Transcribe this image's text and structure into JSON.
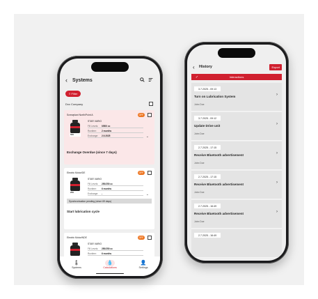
{
  "left": {
    "header": {
      "back": "‹",
      "title": "Systems",
      "search_icon": "search-icon",
      "sort_icon": "sort-icon"
    },
    "filter_label": "≡ Filter",
    "company": "Dxx Company",
    "cards": [
      {
        "name": "Screwplant North/Point A",
        "status": "OFF",
        "product": "STAR VARIO",
        "size": "500",
        "rows": [
          {
            "key": "Fill Levels:",
            "value": "0/500 cc"
          },
          {
            "key": "Runtime:",
            "value": "2 months"
          },
          {
            "key": "Exchange:",
            "value": "2.9.2025"
          }
        ],
        "message": "Exchange Overdue (since 7 days)"
      },
      {
        "name": "Electric Motor/DE",
        "status": "OFF",
        "product": "STAR VARIO",
        "size": "250",
        "rows": [
          {
            "key": "Fill Levels:",
            "value": "250/250 cc"
          },
          {
            "key": "Runtime:",
            "value": "6 months"
          },
          {
            "key": "Exchange:",
            "value": "-"
          }
        ],
        "sync_note": "Synchronisation pending (since 69 days)",
        "message": "Start lubrication cycle"
      },
      {
        "name": "Electric Motor/NDE",
        "status": "OFF",
        "product": "STAR VARIO",
        "size": "250",
        "rows": [
          {
            "key": "Fill Levels:",
            "value": "250/250 cc"
          },
          {
            "key": "Runtime:",
            "value": "6 months"
          }
        ]
      }
    ],
    "tabs": [
      {
        "label": "Systems",
        "icon": "🌡"
      },
      {
        "label": "Calculations",
        "icon": "💧"
      },
      {
        "label": "Settings",
        "icon": "👤"
      }
    ]
  },
  "right": {
    "header": {
      "back": "‹",
      "title": "History",
      "export": "Export"
    },
    "interactions_bar": {
      "check": "✓",
      "label": "Interactions"
    },
    "entries": [
      {
        "date": "3.7.2025 - 09:13",
        "action": "Turn on Lubrication System",
        "user": "John Doe"
      },
      {
        "date": "3.7.2025 - 09:12",
        "action": "Update Drive unit",
        "user": "John Doe"
      },
      {
        "date": "2.7.2025 - 17:15",
        "action": "Receive Bluetooth advertisement",
        "user": "John Doe"
      },
      {
        "date": "2.7.2025 - 17:15",
        "action": "Receive Bluetooth advertisement",
        "user": "John Doe"
      },
      {
        "date": "2.7.2025 - 16:49",
        "action": "Receive Bluetooth advertisement",
        "user": "John Doe"
      },
      {
        "date": "2.7.2025 - 16:49",
        "action": "",
        "user": ""
      }
    ]
  }
}
